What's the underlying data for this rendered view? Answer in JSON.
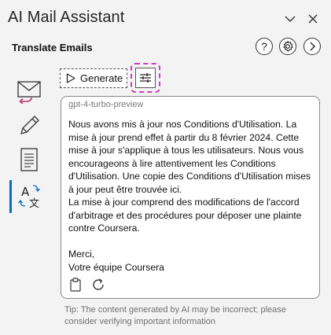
{
  "window": {
    "title": "AI Mail Assistant",
    "collapse_icon": "chevron-down-icon",
    "close_icon": "close-icon"
  },
  "panel": {
    "title": "Translate Emails",
    "help_icon": "help-icon",
    "settings_icon": "gear-icon",
    "forward_icon": "chevron-right-icon"
  },
  "sidebar": {
    "items": [
      {
        "icon": "reply-mail-icon",
        "active": false
      },
      {
        "icon": "pencil-icon",
        "active": false
      },
      {
        "icon": "document-icon",
        "active": false
      },
      {
        "icon": "translate-icon",
        "active": true
      }
    ]
  },
  "toolbar": {
    "generate_label": "Generate",
    "settings_icon": "sliders-icon"
  },
  "result": {
    "model": "gpt-4-turbo-preview",
    "text": "Nous avons mis à jour nos Conditions d'Utilisation. La mise à jour prend effet à partir du 8 février 2024. Cette mise à jour s'applique à tous les utilisateurs. Nous vous encourageons à lire attentivement les Conditions d'Utilisation. Une copie des Conditions d'Utilisation mises à jour peut être trouvée ici.\nLa mise à jour comprend des modifications de l'accord d'arbitrage et des procédures pour déposer une plainte contre Coursera.\n\nMerci,\nVotre équipe Coursera",
    "copy_icon": "clipboard-icon",
    "regenerate_icon": "refresh-icon"
  },
  "tip": "Tip: The content generated by AI may be incorrect; please consider verifying important information",
  "colors": {
    "accent": "#0f6cbd",
    "highlight": "#d23ac8",
    "reply_arrow": "#c0336b"
  }
}
